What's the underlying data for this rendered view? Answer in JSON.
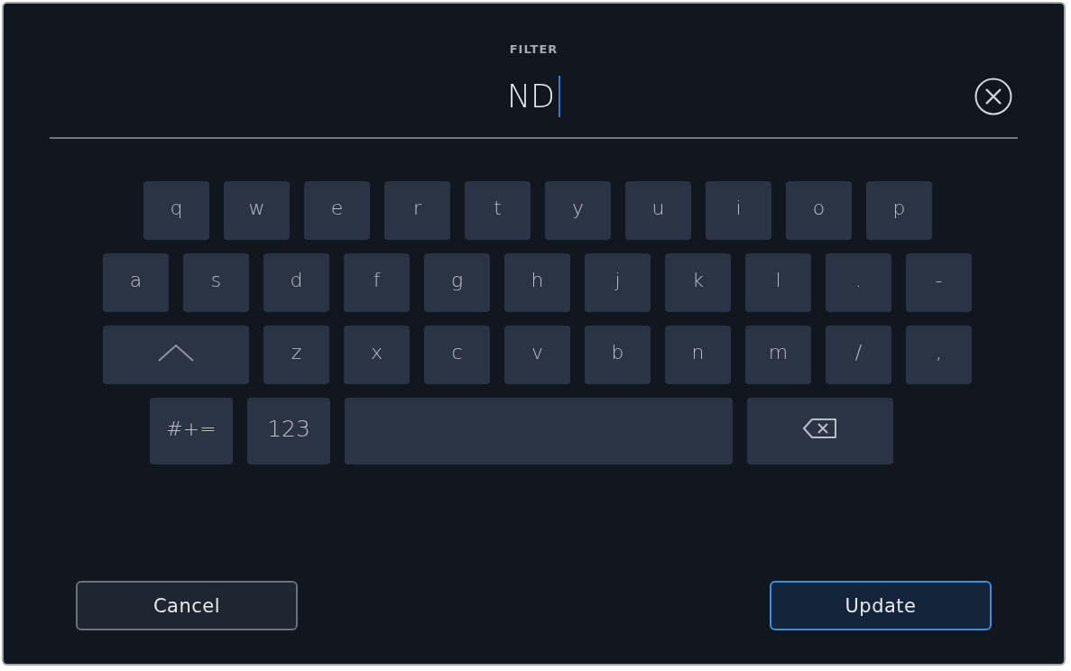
{
  "field": {
    "label": "FILTER",
    "value": "ND",
    "focused": true
  },
  "keyboard": {
    "rows": [
      {
        "keys": [
          {
            "kind": "char",
            "label": "q"
          },
          {
            "kind": "char",
            "label": "w"
          },
          {
            "kind": "char",
            "label": "e"
          },
          {
            "kind": "char",
            "label": "r"
          },
          {
            "kind": "char",
            "label": "t"
          },
          {
            "kind": "char",
            "label": "y"
          },
          {
            "kind": "char",
            "label": "u"
          },
          {
            "kind": "char",
            "label": "i"
          },
          {
            "kind": "char",
            "label": "o"
          },
          {
            "kind": "char",
            "label": "p"
          }
        ]
      },
      {
        "keys": [
          {
            "kind": "char",
            "label": "a"
          },
          {
            "kind": "char",
            "label": "s"
          },
          {
            "kind": "char",
            "label": "d"
          },
          {
            "kind": "char",
            "label": "f"
          },
          {
            "kind": "char",
            "label": "g"
          },
          {
            "kind": "char",
            "label": "h"
          },
          {
            "kind": "char",
            "label": "j"
          },
          {
            "kind": "char",
            "label": "k"
          },
          {
            "kind": "char",
            "label": "l"
          },
          {
            "kind": "char",
            "label": "."
          },
          {
            "kind": "char",
            "label": "-"
          }
        ]
      },
      {
        "keys": [
          {
            "kind": "shift"
          },
          {
            "kind": "char",
            "label": "z"
          },
          {
            "kind": "char",
            "label": "x"
          },
          {
            "kind": "char",
            "label": "c"
          },
          {
            "kind": "char",
            "label": "v"
          },
          {
            "kind": "char",
            "label": "b"
          },
          {
            "kind": "char",
            "label": "n"
          },
          {
            "kind": "char",
            "label": "m"
          },
          {
            "kind": "char",
            "label": "/"
          },
          {
            "kind": "char",
            "label": ","
          }
        ]
      },
      {
        "keys": [
          {
            "kind": "symbols",
            "label": "#+="
          },
          {
            "kind": "numbers",
            "label": "123"
          },
          {
            "kind": "space"
          },
          {
            "kind": "backspace"
          }
        ]
      }
    ]
  },
  "buttons": [
    {
      "label": "Cancel",
      "kind": "secondary"
    },
    {
      "label": "Update",
      "kind": "primary"
    }
  ]
}
